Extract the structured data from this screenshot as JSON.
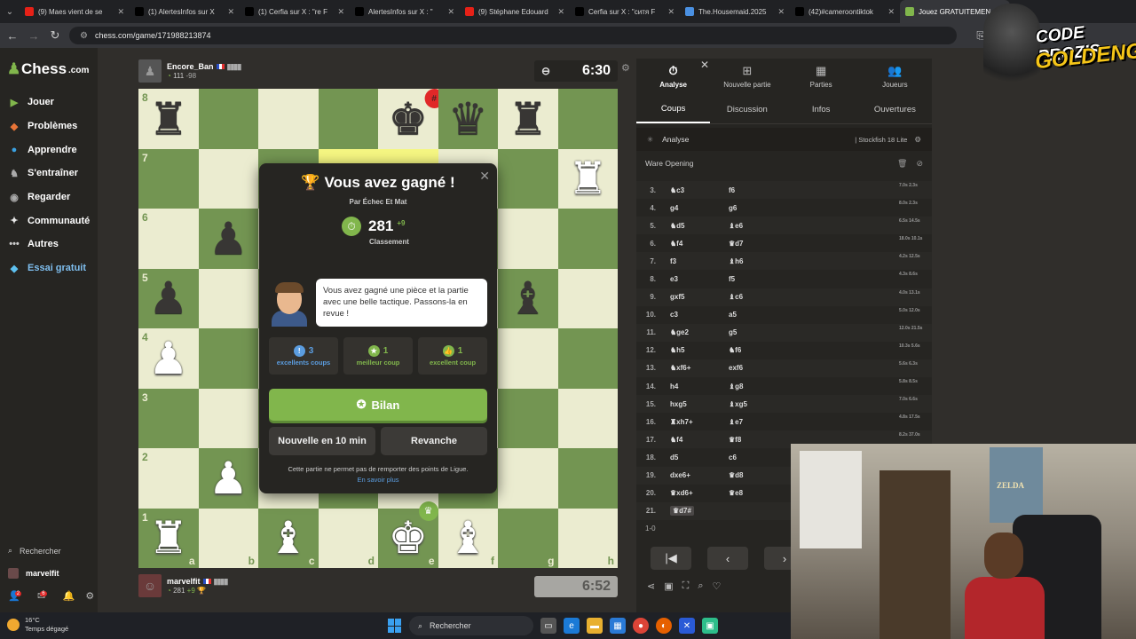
{
  "browser": {
    "tabs": [
      {
        "title": "(9) Maes vient de se",
        "fav": "youtube-icon",
        "color": "#e62117"
      },
      {
        "title": "(1) AlertesInfos sur X",
        "fav": "x-icon",
        "color": "#000000"
      },
      {
        "title": "(1) Cerfia sur X : \"re F",
        "fav": "x-icon",
        "color": "#000000"
      },
      {
        "title": "AlertesInfos sur X : \"",
        "fav": "x-icon",
        "color": "#000000"
      },
      {
        "title": "(9) Stéphane Edouard",
        "fav": "youtube-icon",
        "color": "#e62117"
      },
      {
        "title": "Cerfia sur X : \"ситя F",
        "fav": "x-icon",
        "color": "#000000"
      },
      {
        "title": "The.Housemaid.2025",
        "fav": "globe-icon",
        "color": "#4a90e2"
      },
      {
        "title": "(42)#cameroontiktok",
        "fav": "tiktok-icon",
        "color": "#000000"
      },
      {
        "title": "Jouez GRATUITEMEN",
        "fav": "chess-icon",
        "color": "#81b64c",
        "active": true
      }
    ],
    "url": "chess.com/game/171988213874"
  },
  "sidebar": {
    "logo": "Chess",
    "logo_suffix": ".com",
    "items": [
      {
        "label": "Jouer",
        "icon": "play-icon",
        "glyph": "▶",
        "color": "#81b64c"
      },
      {
        "label": "Problèmes",
        "icon": "puzzle-icon",
        "glyph": "◆",
        "color": "#e87437"
      },
      {
        "label": "Apprendre",
        "icon": "learn-icon",
        "glyph": "●",
        "color": "#3aa0e0"
      },
      {
        "label": "S'entraîner",
        "icon": "train-icon",
        "glyph": "♞",
        "color": "#aaaaaa"
      },
      {
        "label": "Regarder",
        "icon": "watch-icon",
        "glyph": "◉",
        "color": "#aaaaaa"
      },
      {
        "label": "Communauté",
        "icon": "community-icon",
        "glyph": "✦",
        "color": "#e8e8e8"
      },
      {
        "label": "Autres",
        "icon": "more-icon",
        "glyph": "•••",
        "color": "#cccccc"
      },
      {
        "label": "Essai gratuit",
        "icon": "diamond-icon",
        "glyph": "◆",
        "color": "#5ec1f0"
      }
    ],
    "search": "Rechercher",
    "user": "marvelfit",
    "notif_counts": [
      "2",
      "6"
    ]
  },
  "game": {
    "top_player": {
      "name": "Encore_Ban",
      "rating": "111",
      "delta": "-98"
    },
    "bottom_player": {
      "name": "marvelfit",
      "rating": "281",
      "delta": "+9"
    },
    "top_clock": "6:30",
    "bottom_clock": "6:52",
    "ranks": [
      "8",
      "7",
      "6",
      "5",
      "4",
      "3",
      "2",
      "1"
    ],
    "files": [
      "a",
      "b",
      "c",
      "d",
      "e",
      "f",
      "g",
      "h"
    ],
    "position": [
      [
        "bR",
        "",
        "",
        "",
        "bK",
        "bQ",
        "bR",
        ""
      ],
      [
        "",
        "",
        "",
        "",
        "",
        "",
        "",
        "wR"
      ],
      [
        "",
        "bP",
        "",
        "",
        "",
        "",
        "",
        ""
      ],
      [
        "bP",
        "",
        "",
        "",
        "",
        "",
        "bB",
        ""
      ],
      [
        "wP",
        "",
        "",
        "",
        "",
        "",
        "",
        ""
      ],
      [
        "",
        "",
        "",
        "",
        "",
        "",
        "",
        ""
      ],
      [
        "",
        "wP",
        "",
        "",
        "",
        "",
        "",
        ""
      ],
      [
        "wR",
        "",
        "wB",
        "",
        "wK",
        "wB",
        "",
        ""
      ]
    ]
  },
  "modal": {
    "title": "Vous avez gagné !",
    "reason": "Par Échec Et Mat",
    "rating": "281",
    "rating_delta": "+9",
    "rating_label": "Classement",
    "coach_text": "Vous avez gagné une pièce et la partie avec une belle tactique. Passons-la en revue !",
    "stats": [
      {
        "count": "3",
        "label": "excellents coups",
        "color": "#5b9de0",
        "icon": "!"
      },
      {
        "count": "1",
        "label": "meilleur coup",
        "color": "#81b64c",
        "icon": "★"
      },
      {
        "count": "1",
        "label": "excellent coup",
        "color": "#81b64c",
        "icon": "👍"
      }
    ],
    "review_button": "Bilan",
    "new_game_button": "Nouvelle en 10 min",
    "rematch_button": "Revanche",
    "note": "Cette partie ne permet pas de remporter des points de Ligue.",
    "learn_more": "En savoir plus"
  },
  "panel": {
    "tabs": [
      {
        "label": "Analyse",
        "glyph": "⏱",
        "icon": "analysis-icon"
      },
      {
        "label": "Nouvelle partie",
        "glyph": "⊞",
        "icon": "new-game-icon"
      },
      {
        "label": "Parties",
        "glyph": "▦",
        "icon": "games-icon"
      },
      {
        "label": "Joueurs",
        "glyph": "👥",
        "icon": "players-icon"
      }
    ],
    "subtabs": [
      "Coups",
      "Discussion",
      "Infos",
      "Ouvertures"
    ],
    "engine_label": "Analyse",
    "engine_name": "Stockfish 18 Lite",
    "opening": "Ware Opening",
    "moves": [
      {
        "n": "3.",
        "w": "♞c3",
        "b": "f6",
        "t": "7.0s 2.3s"
      },
      {
        "n": "4.",
        "w": "g4",
        "b": "g6",
        "t": "8.0s 2.3s"
      },
      {
        "n": "5.",
        "w": "♞d5",
        "b": "♝e6",
        "t": "6.5s 14.5s"
      },
      {
        "n": "6.",
        "w": "♞f4",
        "b": "♛d7",
        "t": "18.0s 10.1s"
      },
      {
        "n": "7.",
        "w": "f3",
        "b": "♝h6",
        "t": "4.2s 12.5s"
      },
      {
        "n": "8.",
        "w": "e3",
        "b": "f5",
        "t": "4.3s 8.6s"
      },
      {
        "n": "9.",
        "w": "gxf5",
        "b": "♝c6",
        "t": "4.0s 13.1s"
      },
      {
        "n": "10.",
        "w": "c3",
        "b": "a5",
        "t": "5.0s 12.0s"
      },
      {
        "n": "11.",
        "w": "♞ge2",
        "b": "g5",
        "t": "12.0s 21.5s"
      },
      {
        "n": "12.",
        "w": "♞h5",
        "b": "♞f6",
        "t": "10.3s 5.6s"
      },
      {
        "n": "13.",
        "w": "♞xf6+",
        "b": "exf6",
        "t": "5.6s 6.3s"
      },
      {
        "n": "14.",
        "w": "h4",
        "b": "♝g8",
        "t": "5.8s 8.5s"
      },
      {
        "n": "15.",
        "w": "hxg5",
        "b": "♝xg5",
        "t": "7.0s 6.6s"
      },
      {
        "n": "16.",
        "w": "♜xh7+",
        "b": "♝e7",
        "t": "4.8s 17.5s"
      },
      {
        "n": "17.",
        "w": "♞f4",
        "b": "♛f8",
        "t": "8.2s 37.0s"
      },
      {
        "n": "18.",
        "w": "d5",
        "b": "c6",
        "t": ""
      },
      {
        "n": "19.",
        "w": "dxe6+",
        "b": "♛d8",
        "t": ""
      },
      {
        "n": "20.",
        "w": "♛xd6+",
        "b": "♛e8",
        "t": ""
      },
      {
        "n": "21.",
        "w": "♛d7#",
        "b": "",
        "t": "",
        "current": true
      }
    ],
    "result": "1-0"
  },
  "overlay": {
    "promo_line1": "CODE PROZIS",
    "promo_line2": "GOLDENG",
    "poster_text": "ZELDA"
  },
  "taskbar": {
    "temp": "16°C",
    "weather": "Temps dégagé",
    "search": "Rechercher"
  }
}
